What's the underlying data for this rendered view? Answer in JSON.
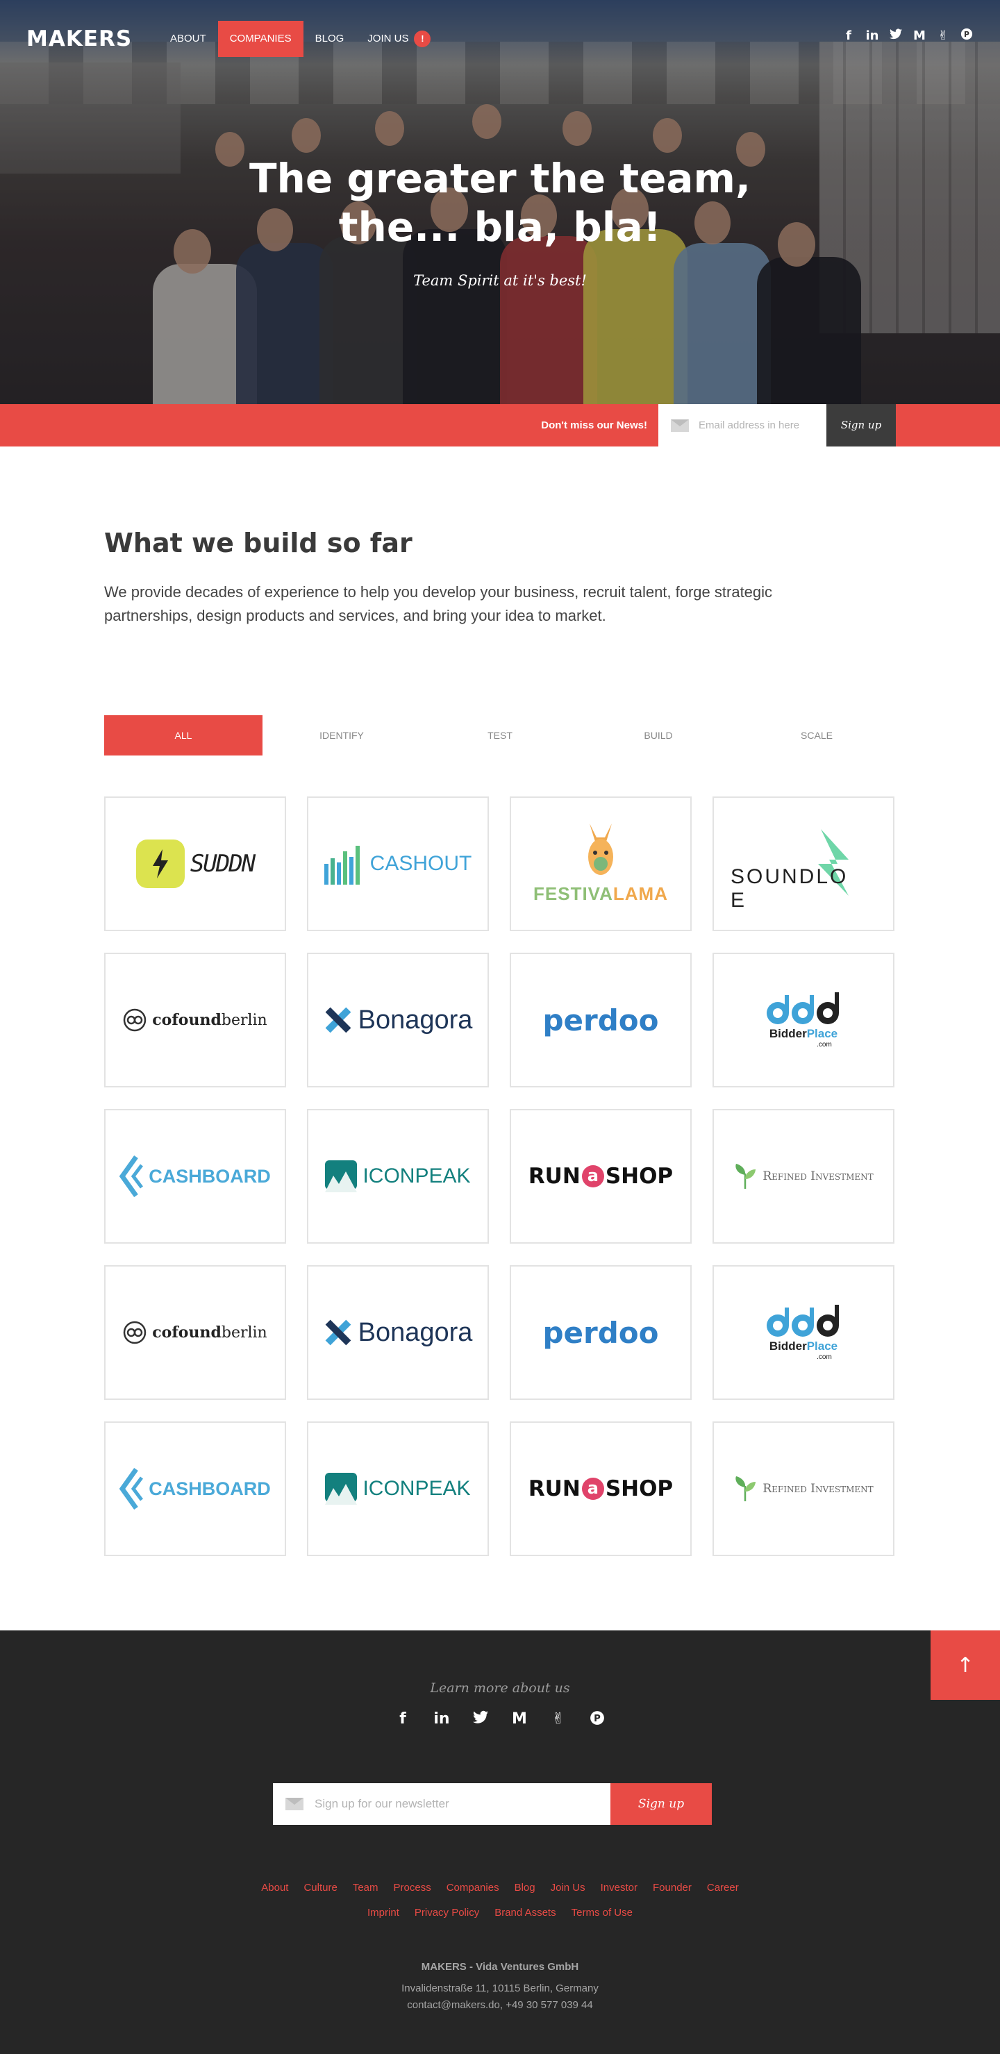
{
  "brand": {
    "logo": "MAKERS"
  },
  "nav": {
    "items": [
      "About",
      "Companies",
      "Blog",
      "Join Us"
    ],
    "active": "Companies",
    "join_badge": "!"
  },
  "social_icons": [
    "facebook-icon",
    "linkedin-icon",
    "twitter-icon",
    "medium-icon",
    "angellist-icon",
    "producthunt-icon"
  ],
  "social_glyphs": [
    "f",
    "in",
    "t",
    "M",
    "✌",
    "P"
  ],
  "hero": {
    "title_line1": "The greater the team,",
    "title_line2": "the... bla, bla!",
    "subtitle": "Team Spirit at it's best!"
  },
  "newsletter_strip": {
    "label": "Don't miss our News!",
    "placeholder": "Email address in here",
    "button": "Sign up"
  },
  "intro": {
    "title": "What we build so far",
    "text": "We provide decades of experience to help you develop your business, recruit talent, forge strategic partnerships, design products and services, and bring your idea to market."
  },
  "filters": {
    "tabs": [
      "All",
      "Identify",
      "Test",
      "Build",
      "Scale"
    ],
    "active": "All"
  },
  "companies": [
    "SUDDN",
    "CASHOUT",
    "FESTIVALAMA",
    "SOUNDLOVE",
    "cofoundberlin",
    "Bonagora",
    "perdoo",
    "BidderPlace",
    "CASHBOARD",
    "ICONPEAK",
    "RUNaSHOP",
    "Refined Investment",
    "cofoundberlin",
    "Bonagora",
    "perdoo",
    "BidderPlace",
    "CASHBOARD",
    "ICONPEAK",
    "RUNaSHOP",
    "Refined Investment"
  ],
  "logo_parts": {
    "cofound_bold": "cofound",
    "cofound_light": "berlin",
    "festiva": "FESTIVA",
    "lama": "LAMA",
    "soundlo": "SOUNDLO",
    "soundlove_e": "E",
    "run": "RUN",
    "run_a": "a",
    "shop": "SHOP",
    "bidder": "Bidder",
    "place": "Place",
    "dotcom": ".com"
  },
  "colors": {
    "accent": "#e84b45",
    "dark": "#262626",
    "strip_button": "#3c3c3c"
  },
  "footer": {
    "learn": "Learn more about us",
    "newsletter_placeholder": "Sign up for our newsletter",
    "newsletter_button": "Sign up",
    "links_row1": [
      "About",
      "Culture",
      "Team",
      "Process",
      "Companies",
      "Blog",
      "Join Us",
      "Investor",
      "Founder",
      "Career"
    ],
    "links_row2": [
      "Imprint",
      "Privacy Policy",
      "Brand Assets",
      "Terms of Use"
    ],
    "company": "MAKERS - Vida Ventures GmbH",
    "address": "Invalidenstraße 11, 10115 Berlin, Germany",
    "contact": "contact@makers.do, +49 30 577 039 44",
    "to_top_icon": "arrow-up-icon"
  }
}
